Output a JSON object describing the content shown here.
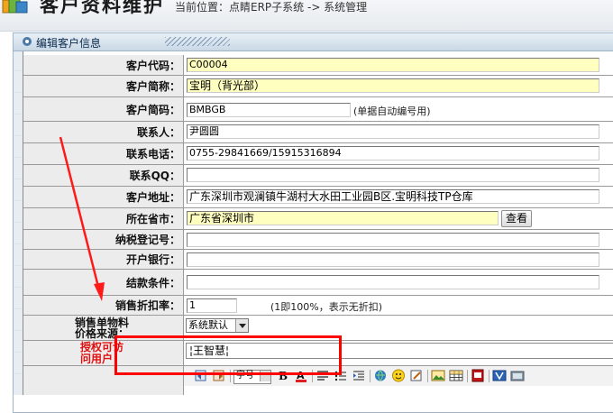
{
  "header": {
    "title": "客户资料维护",
    "location_prefix": "当前位置：",
    "location_path": "点睛ERP子系统 -> 系统管理"
  },
  "panel": {
    "title": "编辑客户信息"
  },
  "form": {
    "code": {
      "label": "客户代码：",
      "value": "C00004"
    },
    "short_name": {
      "label": "客户简称：",
      "value": "宝明（背光部）"
    },
    "abbr": {
      "label": "客户简码：",
      "value": "BMBGB",
      "hint": "(单据自动编号用)"
    },
    "contact": {
      "label": "联系人：",
      "value": "尹圆圆"
    },
    "phone": {
      "label": "联系电话：",
      "value": "0755-29841669/15915316894"
    },
    "qq": {
      "label": "联系QQ：",
      "value": ""
    },
    "address": {
      "label": "客户地址：",
      "value": "广东深圳市观澜镇牛湖村大水田工业园B区.宝明科技TP仓库"
    },
    "city": {
      "label": "所在省市：",
      "value": "广东省深圳市",
      "button": "查看"
    },
    "tax_no": {
      "label": "纳税登记号：",
      "value": ""
    },
    "bank": {
      "label": "开户银行：",
      "value": ""
    },
    "terms": {
      "label": "结款条件：",
      "value": ""
    },
    "discount": {
      "label": "销售折扣率：",
      "value": "1",
      "hint": "(1即100%，表示无折扣)"
    },
    "price_source": {
      "label_line1": "销售单物料",
      "label_line2": "价格来源：",
      "selected": "系统默认"
    },
    "authorized": {
      "label_line1": "授权可访",
      "label_line2": "问用户：",
      "value": "¦王智慧¦"
    }
  },
  "toolbar_icons": [
    "undo-icon",
    "redo-icon",
    "font-size-select",
    "bold-icon",
    "font-color-icon",
    "align-icon",
    "list-icon",
    "indent-icon",
    "link-icon",
    "emoticon-icon",
    "edit-icon",
    "image-icon",
    "table-icon",
    "flash-icon",
    "media-icon",
    "preview-icon"
  ],
  "colors": {
    "required_field": "#ffffc0",
    "annotation": "#ff0000",
    "label_bg": "#ececec"
  }
}
